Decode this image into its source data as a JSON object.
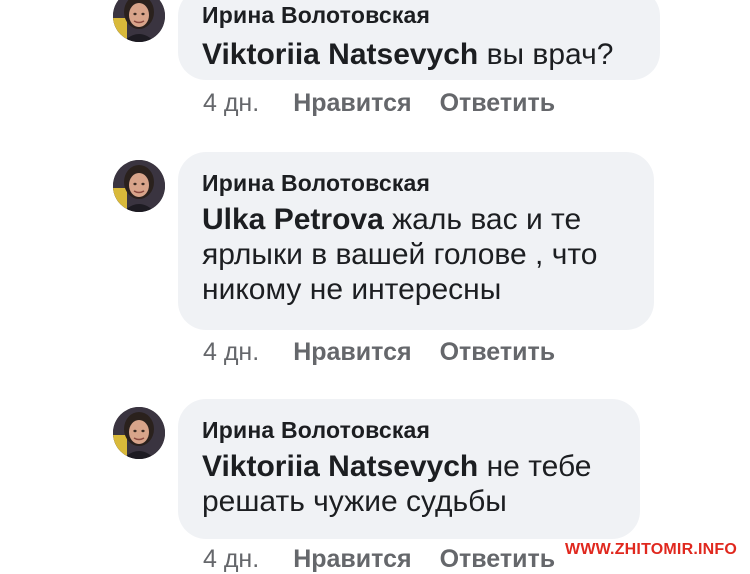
{
  "comments": [
    {
      "author": "Ирина Волотовская",
      "mention": "Viktoriia Natsevych",
      "text": " вы врач?",
      "time": "4 дн.",
      "like": "Нравится",
      "reply": "Ответить"
    },
    {
      "author": "Ирина Волотовская",
      "mention": "Ulka Petrova",
      "text": " жаль вас и те ярлыки в вашей голове , что никому не интересны",
      "time": "4 дн.",
      "like": "Нравится",
      "reply": "Ответить"
    },
    {
      "author": "Ирина Волотовская",
      "mention": "Viktoriia Natsevych",
      "text": " не тебе решать чужие судьбы",
      "time": "4 дн.",
      "like": "Нравится",
      "reply": "Ответить"
    }
  ],
  "watermark": "WWW.ZHITOMIR.INFO",
  "colors": {
    "bubble": "#f0f2f5",
    "meta_text": "#65676b",
    "watermark": "#e0281e"
  },
  "icons": {
    "avatar": "user-avatar-photo"
  }
}
